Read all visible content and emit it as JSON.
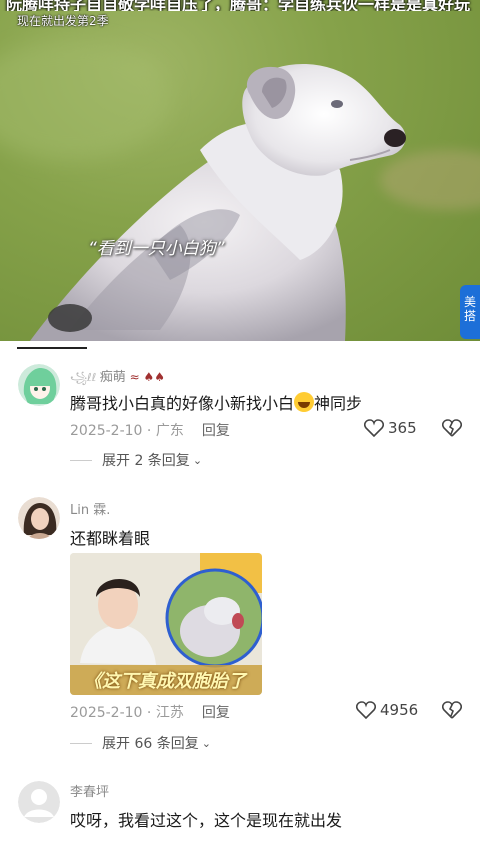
{
  "video": {
    "top_caption": "阮腾咩持子自自敬学咩自压了，腾哥：学自练兵伙一样是是真好玩",
    "sub_caption": "现在就出发第2季",
    "quote": "“看到一只小白狗”",
    "logo_text": "美 搭"
  },
  "comments": [
    {
      "username": "痴萌",
      "text_before": "腾哥找小白真的好像小新找小白",
      "text_after": "神同步",
      "date": "2025-2-10",
      "location": "广东",
      "reply_label": "回复",
      "likes": "365",
      "expand_label": "展开 2 条回复"
    },
    {
      "username": "Lin 霖.",
      "text": "还都眯着眼",
      "image_caption": "《这下真成双胞胎了",
      "date": "2025-2-10",
      "location": "江苏",
      "reply_label": "回复",
      "likes": "4956",
      "expand_label": "展开 66 条回复"
    },
    {
      "username": "李春坪",
      "text": "哎呀，我看过这个，这个是现在就出发"
    }
  ],
  "colors": {
    "accent_badge": "#1d6fd8",
    "meta_gray": "#9a9a9a"
  }
}
